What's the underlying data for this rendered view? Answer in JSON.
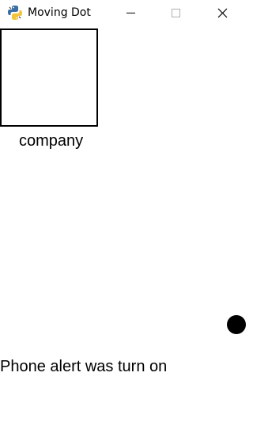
{
  "window": {
    "title": "Moving Dot",
    "app_icon": "python-snake-icon",
    "controls": {
      "minimize": "minimize-icon",
      "maximize": "maximize-icon",
      "close": "close-icon"
    }
  },
  "scene": {
    "box_label": "company",
    "status_text": "Phone alert was turn on",
    "dot_color": "#000000",
    "box_border_color": "#000000"
  }
}
